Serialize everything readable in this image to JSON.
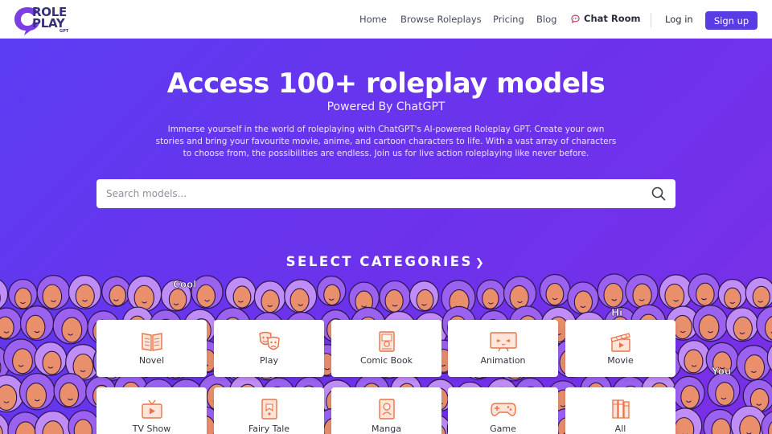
{
  "brand": {
    "logo_line1": "ROLE",
    "logo_line2": "PLAY",
    "logo_line3": "GPT",
    "brand_color": "#35307a",
    "logo_accent": "#7b3fe4"
  },
  "nav": {
    "home": "Home",
    "browse": "Browse Roleplays",
    "pricing": "Pricing",
    "blog": "Blog",
    "chat_room": "Chat Room",
    "login": "Log in",
    "signup": "Sign up"
  },
  "hero": {
    "title": "Access 100+ roleplay models",
    "subtitle": "Powered By ChatGPT",
    "description": "Immerse yourself in the world of roleplaying with ChatGPT's AI-powered Roleplay GPT. Create your own stories and bring your favourite movie, anime, and cartoon characters to life. With a vast array of characters to choose from, the possibilities are endless. Join us for live action roleplaying like never before."
  },
  "search": {
    "placeholder": "Search models...",
    "value": ""
  },
  "categories_title": "SELECT CATEGORIES",
  "categories": [
    {
      "label": "Novel",
      "icon": "book-icon"
    },
    {
      "label": "Play",
      "icon": "theater-masks-icon"
    },
    {
      "label": "Comic Book",
      "icon": "comic-book-icon"
    },
    {
      "label": "Animation",
      "icon": "animation-screen-icon"
    },
    {
      "label": "Movie",
      "icon": "clapperboard-icon"
    },
    {
      "label": "TV Show",
      "icon": "tv-icon"
    },
    {
      "label": "Fairy Tale",
      "icon": "fairy-tale-book-icon"
    },
    {
      "label": "Manga",
      "icon": "manga-book-icon"
    },
    {
      "label": "Game",
      "icon": "gamepad-icon"
    },
    {
      "label": "All",
      "icon": "library-books-icon"
    }
  ],
  "crowd_words": [
    "Cool",
    "Hi",
    "You"
  ],
  "colors": {
    "accent": "#5a3ce6",
    "hero_start": "#5b3cf2",
    "hero_end": "#7a2fe6",
    "icon_orange": "#e8734a",
    "crowd_hair": "#9b62f0",
    "crowd_skin": "#e98f6c"
  }
}
